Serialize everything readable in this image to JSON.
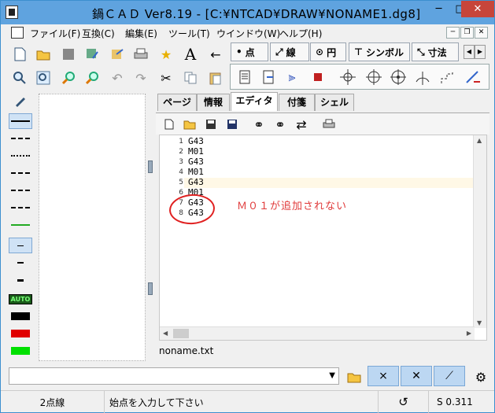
{
  "title": "鍋ＣＡＤ Ver8.19 - [C:¥NTCAD¥DRAW¥NONAME1.dg8]",
  "menu": [
    "ファイル(F)",
    "互換(C)",
    "編集(E)",
    "ツール(T)",
    "ウインドウ(W)",
    "ヘルプ(H)"
  ],
  "ribbon_tabs": [
    "点",
    "線",
    "円",
    "シンボル",
    "寸法"
  ],
  "panel_tabs": [
    "ページ",
    "情報",
    "エディタ",
    "付箋",
    "シェル"
  ],
  "editor": {
    "line_numbers": [
      "1",
      "2",
      "3",
      "4",
      "5",
      "6",
      "7",
      "8"
    ],
    "lines": [
      "G43",
      "M01",
      "G43",
      "M01",
      "G43",
      "M01",
      "G43",
      "G43"
    ],
    "filename": "noname.txt"
  },
  "annotation": "Ｍ０１が追加されない",
  "palette": {
    "auto_label": "AUTO"
  },
  "status": {
    "mode": "2点線",
    "prompt": "始点を入力して下さい",
    "scale": "S 0.311"
  },
  "colors": {
    "title_bg": "#5fa3df",
    "close_bg": "#c7453a",
    "annotation": "#e03a3a"
  },
  "icons": [
    "new-file-icon",
    "open-folder-icon",
    "save-icon",
    "star-icon",
    "text-a-icon",
    "arrow-left-icon",
    "zoom-icon",
    "undo-icon",
    "redo-icon",
    "cut-icon",
    "copy-icon",
    "paste-icon",
    "print-icon",
    "binoculars-icon",
    "stop-icon",
    "snap-point-icon",
    "snap-circle-icon",
    "snap-center-icon",
    "snap-arc-icon",
    "snap-edge-icon",
    "snap-axis-icon",
    "folder-icon",
    "gear-icon"
  ]
}
